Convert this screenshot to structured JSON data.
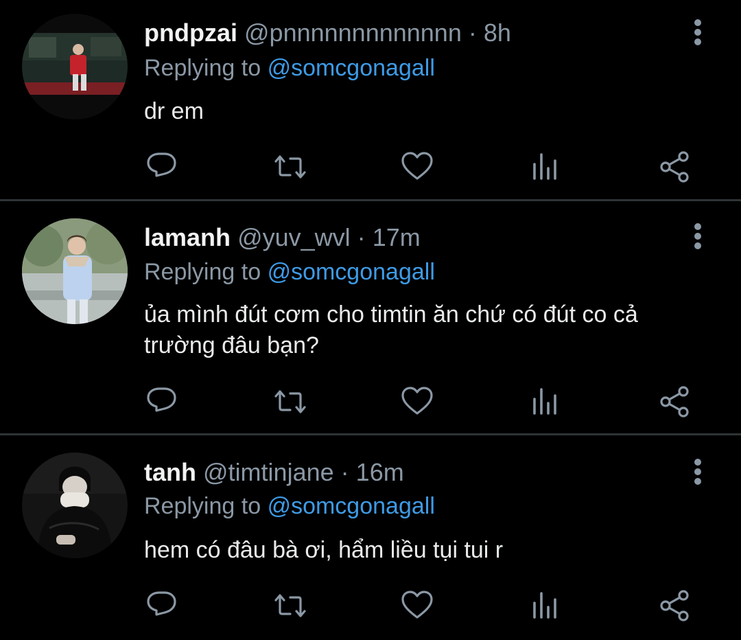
{
  "tweets": [
    {
      "display_name": "pndpzai",
      "handle": "@pnnnnnnnnnnnnn",
      "separator": "·",
      "time": "8h",
      "replying_prefix": "Replying to",
      "replying_to": "@somcgonagall",
      "text": "dr em"
    },
    {
      "display_name": "lamanh",
      "handle": "@yuv_wvl",
      "separator": "·",
      "time": "17m",
      "replying_prefix": "Replying to",
      "replying_to": "@somcgonagall",
      "text": "ủa mình đút cơm cho timtin ăn chứ có đút co cả trường đâu bạn?"
    },
    {
      "display_name": "tanh",
      "handle": "@timtinjane",
      "separator": "·",
      "time": "16m",
      "replying_prefix": "Replying to",
      "replying_to": "@somcgonagall",
      "text": "hem có đâu bà ơi, hẩm liều tụi tui r"
    }
  ],
  "icons": {
    "reply": "reply-icon",
    "retweet": "retweet-icon",
    "like": "heart-icon",
    "stats": "stats-icon",
    "share": "share-icon",
    "more": "more-vertical-icon"
  },
  "colors": {
    "background": "#000000",
    "text": "#e7e9ea",
    "secondary": "#8b98a5",
    "mention": "#3e9be6",
    "divider": "#2f3336"
  }
}
